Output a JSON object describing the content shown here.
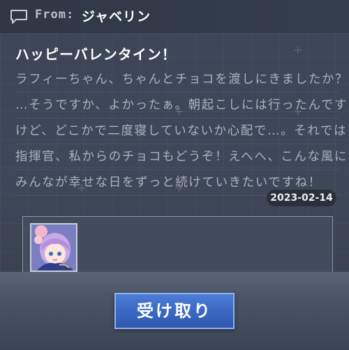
{
  "header": {
    "from_label": "From:",
    "sender": "ジャベリン",
    "icon": "message-icon"
  },
  "message": {
    "title": "ハッピーバレンタイン！",
    "lines": [
      "ラフィーちゃん、ちゃんとチョコを渡しにきましたか？",
      "…そうですか、よかったぁ。朝起こしには行ったんです",
      "けど、どこかで二度寝していないか心配で…。それでは",
      "指揮官、私からのチョコもどうぞ！えへへ、こんな風に",
      "みんなが幸せな日をずっと続けていきたいですね！"
    ],
    "date": "2023-02-14"
  },
  "attachment": {
    "item_icon": "character-portrait-icon"
  },
  "claim_button": {
    "label": "受け取り"
  },
  "colors": {
    "accent": "#3a67c2",
    "background": "#3c4556",
    "text_primary": "#ffffff",
    "text_secondary": "#aab1bd"
  }
}
